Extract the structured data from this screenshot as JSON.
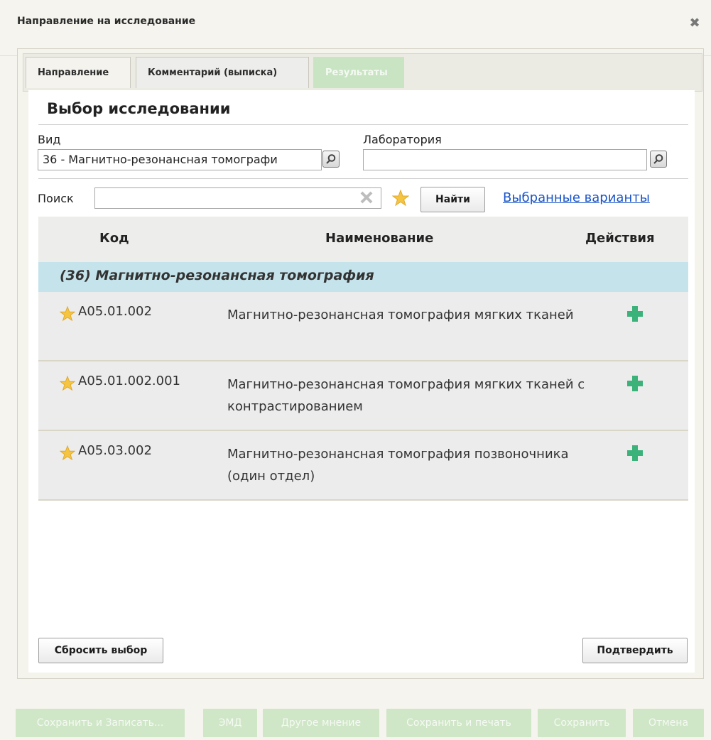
{
  "dialog": {
    "title": "Направление на исследование"
  },
  "tabs": [
    {
      "label": "Направление"
    },
    {
      "label": "Комментарий (выписка)"
    },
    {
      "label": "Результаты"
    }
  ],
  "section": {
    "title": "Выбор исследовании"
  },
  "filters": {
    "vid_label": "Вид",
    "vid_value": "36 - Магнитно-резонансная томографи",
    "lab_label": "Лаборатория",
    "lab_value": "",
    "search_label": "Поиск",
    "search_value": "",
    "find_button": "Найти",
    "selected_link": "Выбранные варианты"
  },
  "table": {
    "headers": {
      "code": "Код",
      "name": "Наименование",
      "actions": "Действия"
    },
    "group": "(36) Магнитно-резонансная томография",
    "rows": [
      {
        "code": "A05.01.002",
        "name": "Магнитно-резонансная томография мягких тканей"
      },
      {
        "code": "A05.01.002.001",
        "name": "Магнитно-резонансная томография мягких тканей с контрастированием"
      },
      {
        "code": "A05.03.002",
        "name": "Магнитно-резонансная томография позвоночника (один отдел)"
      }
    ]
  },
  "actions": {
    "reset": "Сбросить выбор",
    "confirm": "Подтвердить"
  },
  "footer": {
    "buttons": [
      {
        "label": "Сохранить и Записать..."
      },
      {
        "label": "ЭМД"
      },
      {
        "label": "Другое мнение"
      },
      {
        "label": "Сохранить и печать"
      },
      {
        "label": "Сохранить"
      },
      {
        "label": "Отмена"
      }
    ]
  },
  "colors": {
    "group_bg": "#c5e3eb",
    "disabled_btn": "#cfe6c7",
    "link": "#1a55c9",
    "star": "#f5c542",
    "plus": "#3bb27a"
  }
}
